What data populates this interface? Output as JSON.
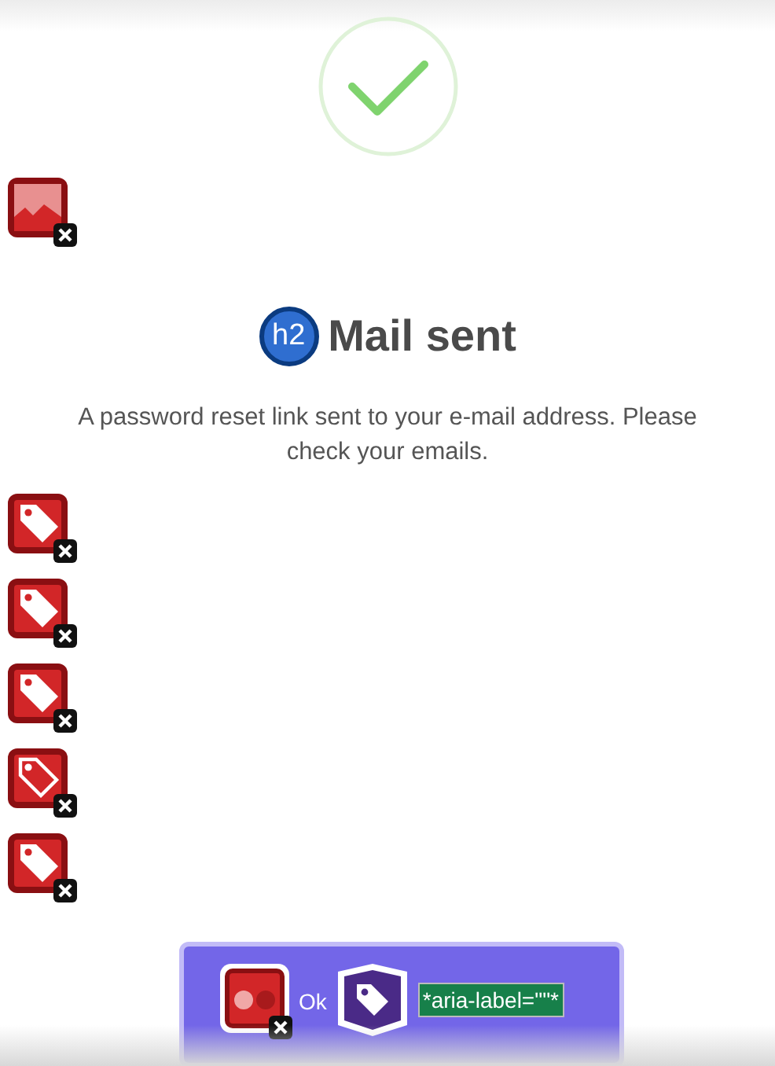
{
  "top_annotation": {
    "kind": "image_error"
  },
  "heading": {
    "level_badge": "h2",
    "text": "Mail sent"
  },
  "message": "A password reset link sent to your e-mail address. Please check your emails.",
  "annotations": [
    {
      "kind": "tag"
    },
    {
      "kind": "tag"
    },
    {
      "kind": "tag"
    },
    {
      "kind": "tag_outline"
    },
    {
      "kind": "tag"
    }
  ],
  "button": {
    "contrast_error": true,
    "label": "Ok",
    "aria_label": "*aria-label=\"\"*"
  }
}
